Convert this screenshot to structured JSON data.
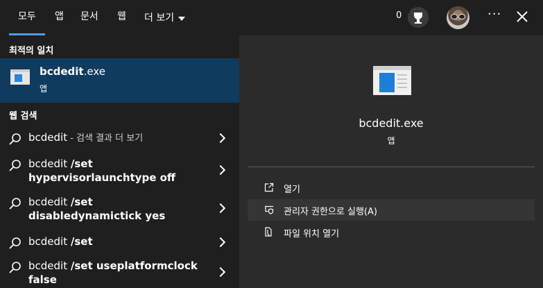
{
  "tabs": [
    {
      "label": "모두",
      "active": true
    },
    {
      "label": "앱"
    },
    {
      "label": "문서"
    },
    {
      "label": "웹"
    },
    {
      "label": "더 보기"
    }
  ],
  "header": {
    "points": "0",
    "trophy_icon": "trophy-icon",
    "more_icon": "ellipsis-icon",
    "close_icon": "close-icon"
  },
  "best_match": {
    "section": "최적의 일치",
    "name_bold": "bcdedit",
    "name_rest": ".exe",
    "type": "앱"
  },
  "web": {
    "section": "웹 검색",
    "items": [
      {
        "prefix": "bcdedit",
        "suffix_dim": " - 검색 결과 더 보기",
        "bold": ""
      },
      {
        "prefix": "bcdedit ",
        "bold": "/set hypervisorlaunchtype off",
        "suffix_dim": ""
      },
      {
        "prefix": "bcdedit ",
        "bold": "/set disabledynamictick yes",
        "suffix_dim": ""
      },
      {
        "prefix": "bcdedit ",
        "bold": "/set",
        "suffix_dim": ""
      },
      {
        "prefix": "bcdedit ",
        "bold": "/set useplatformclock false",
        "suffix_dim": ""
      }
    ]
  },
  "preview": {
    "name": "bcdedit.exe",
    "type": "앱",
    "actions": [
      {
        "label": "열기",
        "icon": "open-icon"
      },
      {
        "label": "관리자 권한으로 실행(A)",
        "icon": "shield-icon"
      },
      {
        "label": "파일 위치 열기",
        "icon": "file-location-icon"
      }
    ]
  },
  "colors": {
    "accent": "#4a9ee8",
    "selected_bg": "#0f3b5f",
    "panel_bg": "#2b2b2b",
    "base_bg": "#1f1f1f"
  }
}
